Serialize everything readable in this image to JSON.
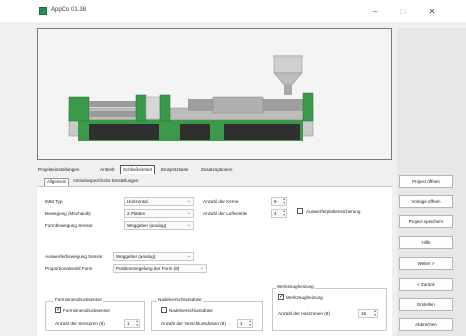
{
  "window": {
    "title": "AppCo 01.38",
    "minimize": "–",
    "maximize": "□",
    "close": "✕"
  },
  "tabs": [
    {
      "label": "Projekteinstellungen"
    },
    {
      "label": "Antrieb"
    },
    {
      "label": "Schließeinheit"
    },
    {
      "label": "Einspritzseite"
    },
    {
      "label": "Zusatzoptionen"
    }
  ],
  "subtabs": [
    {
      "label": "Allgemein"
    },
    {
      "label": "Antriebsspezifische Einstellungen"
    }
  ],
  "fields": {
    "imm_type_label": "IMM Typ",
    "imm_type_value": "Horizontal",
    "movement_label": "Bewegung (Mechanik)",
    "movement_value": "2 Platten",
    "mold_sensor_label": "Formbewegung Sensor",
    "mold_sensor_value": "Weggeber (analog)",
    "cavities_label": "Anzahl der Kerne",
    "cavities_value": "8",
    "air_valves_label": "Anzahl der Luftventile",
    "air_valves_value": "4",
    "ejector_check_label": "Auswerferplattensicherung",
    "ejector_move_label": "Auswerferbewegung Sensor",
    "ejector_move_value": "Weggeber (analog)",
    "prop_valve_label": "Proportionalventil Form",
    "prop_valve_value": "Positionsregelung der Form (8)"
  },
  "groups": {
    "pressure": {
      "title": "Forminnendrucksensor",
      "checkbox_label": "Forminnendrucksensor",
      "count_label": "Anzahl der Sensoren (8)",
      "count_value": "1"
    },
    "needle": {
      "title": "Nadelverschlussdüse",
      "checkbox_label": "Nadelverschlussdüse",
      "count_label": "Anzahl der Verschlussdüsen (8)",
      "count_value": "1"
    },
    "tool_heating": {
      "title": "Werkzeugheizung",
      "checkbox_label": "Werkzeugheizung",
      "count_label": "Anzahl der Heizzonen (8)",
      "count_value": "16"
    }
  },
  "side_buttons": [
    {
      "label": "Project öffnen"
    },
    {
      "label": "Vorlage öffnen"
    },
    {
      "label": "Project speichern"
    },
    {
      "label": "Hilfe"
    },
    {
      "label": "Weiter >"
    },
    {
      "label": "< Zurück"
    },
    {
      "label": "Erstellen"
    },
    {
      "label": "Abbrechen"
    }
  ],
  "colors": {
    "machine_green": "#3a9a4a",
    "machine_dark": "#2f2f2f",
    "machine_gray": "#b9b9b9",
    "accent": "#2e8b57"
  },
  "icons": {
    "app": "app-logo-icon",
    "combo_arrow": "chevron-down-icon",
    "spin": "spinner-icon"
  }
}
